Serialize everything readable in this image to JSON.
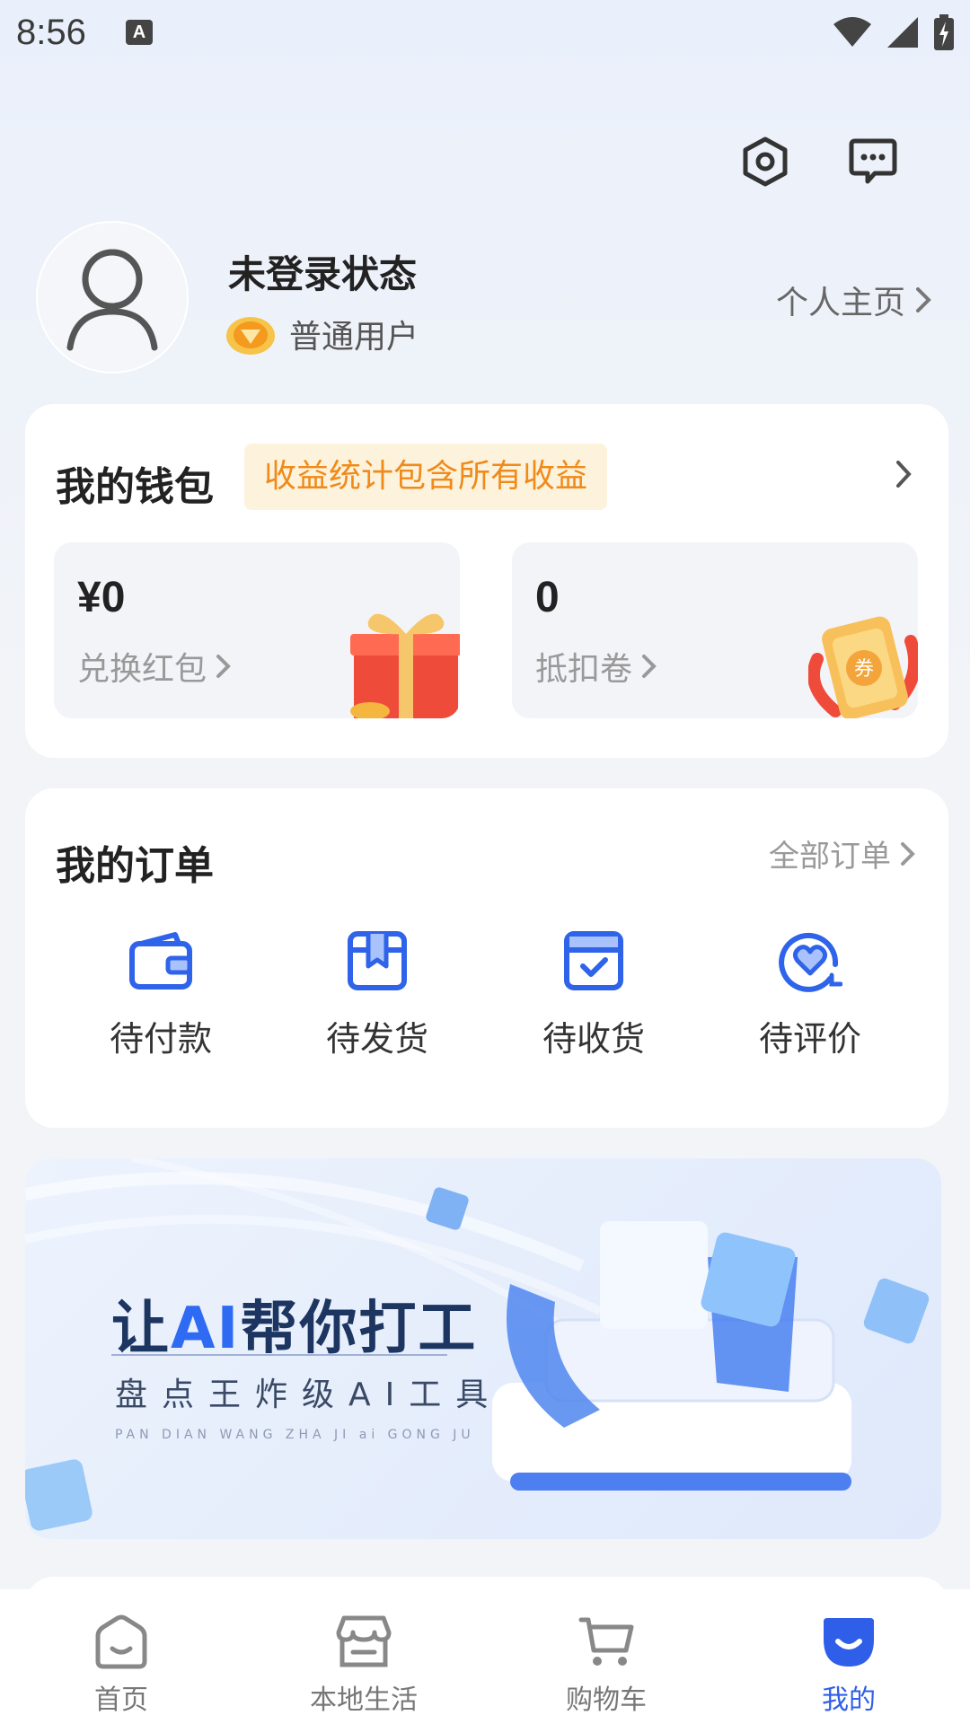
{
  "status_bar": {
    "time": "8:56",
    "notification_icon": "A"
  },
  "top_icons": [
    "settings-icon",
    "message-icon"
  ],
  "profile": {
    "name": "未登录状态",
    "level": "普通用户",
    "homepage_link": "个人主页"
  },
  "wallet": {
    "title": "我的钱包",
    "tag": "收益统计包含所有收益",
    "boxes": [
      {
        "value": "¥0",
        "label": "兑换红包"
      },
      {
        "value": "0",
        "label": "抵扣卷"
      }
    ]
  },
  "orders": {
    "title": "我的订单",
    "all_link": "全部订单",
    "items": [
      {
        "label": "待付款",
        "icon": "wallet-icon"
      },
      {
        "label": "待发货",
        "icon": "package-icon"
      },
      {
        "label": "待收货",
        "icon": "box-check-icon"
      },
      {
        "label": "待评价",
        "icon": "heart-review-icon"
      }
    ]
  },
  "banner": {
    "title_prefix": "让",
    "title_ai": "AI",
    "title_suffix": "帮你打工",
    "subtitle": "盘点王炸级AI工具",
    "pinyin": "PAN DIAN WANG ZHA JI ai GONG JU"
  },
  "bottom_nav": {
    "items": [
      {
        "label": "首页",
        "icon": "home-icon",
        "active": false
      },
      {
        "label": "本地生活",
        "icon": "store-icon",
        "active": false
      },
      {
        "label": "购物车",
        "icon": "cart-icon",
        "active": false
      },
      {
        "label": "我的",
        "icon": "profile-face-icon",
        "active": true
      }
    ]
  },
  "colors": {
    "accent": "#2f5ee8",
    "order_icon": "#2f63e9",
    "tag_text": "#f08a1a",
    "tag_bg": "#fdf3dc"
  }
}
